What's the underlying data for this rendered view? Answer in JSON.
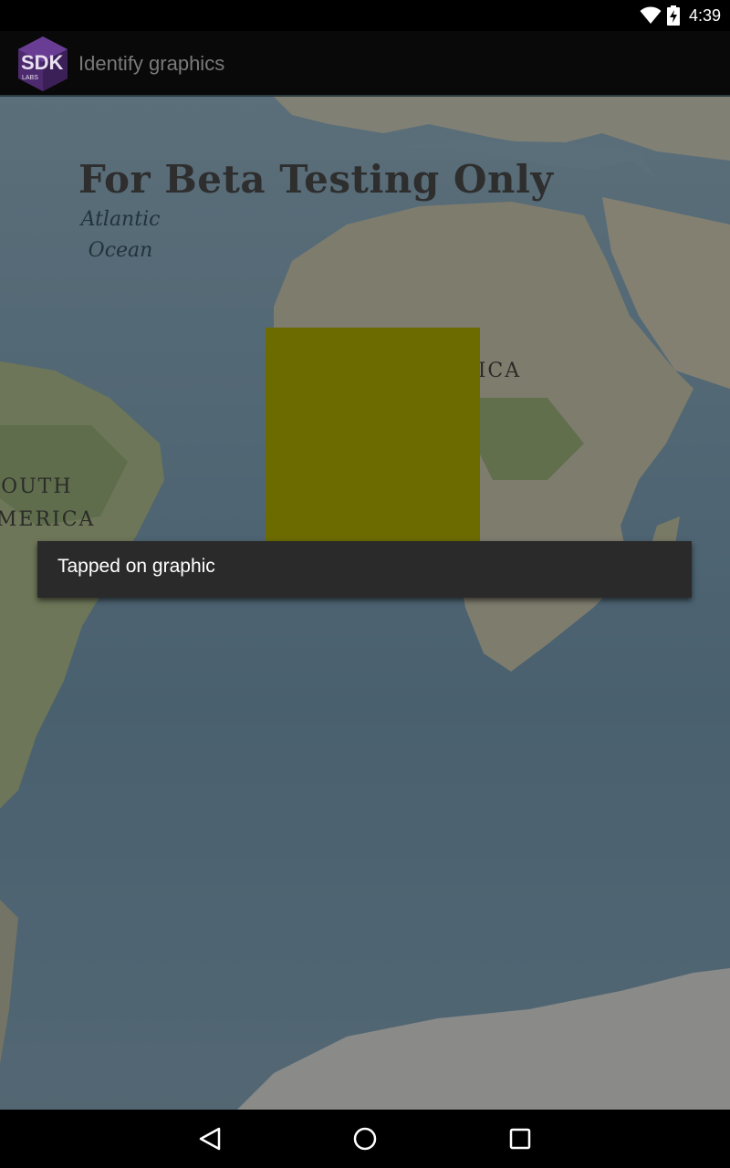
{
  "status_bar": {
    "time": "4:39",
    "icons": [
      "wifi-icon",
      "battery-charging-icon"
    ]
  },
  "action_bar": {
    "logo_text": "SDK",
    "logo_subtext": "LABS",
    "title": "Identify graphics"
  },
  "map": {
    "watermark": "For Beta Testing Only",
    "labels": {
      "ocean_line1": "Atlantic",
      "ocean_line2": "Ocean",
      "africa": "AFRICA",
      "south_america_line1": "SOUTH",
      "south_america_line2": "AMERICA"
    },
    "graphic_color": "#6b6b00"
  },
  "toast": {
    "message": "Tapped on graphic"
  },
  "nav_bar": {
    "buttons": [
      "back-icon",
      "home-icon",
      "recents-icon"
    ]
  }
}
